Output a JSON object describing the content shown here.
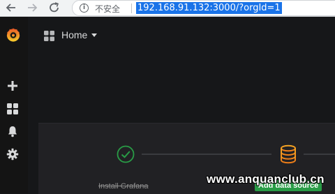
{
  "browser": {
    "security_label": "不安全",
    "url": "192.168.91.132:3000/?orgId=1"
  },
  "sidebar": {
    "items": [
      {
        "icon": "plus-icon",
        "label": "Create"
      },
      {
        "icon": "dashboards-icon",
        "label": "Dashboards"
      },
      {
        "icon": "bell-icon",
        "label": "Alerting"
      },
      {
        "icon": "gear-icon",
        "label": "Configuration"
      }
    ]
  },
  "topnav": {
    "title": "Home"
  },
  "getting_started": {
    "install_label": "Install Grafana",
    "add_data_source_label": "Add data source"
  },
  "watermark": "www.anquanclub.cn",
  "colors": {
    "background": "#161719",
    "sidebar": "#141414",
    "panel": "#212124",
    "success_green": "#299c46",
    "step_orange": "#eb7b18",
    "url_highlight": "#1a73e8"
  }
}
